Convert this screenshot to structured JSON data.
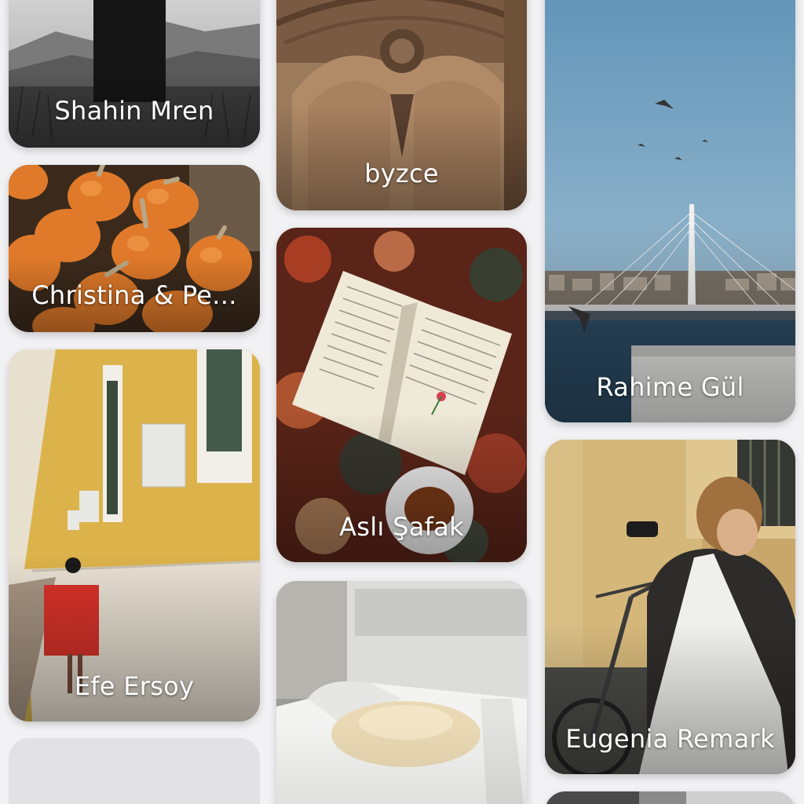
{
  "feed": {
    "cards": [
      {
        "author": "Shahin  Mren",
        "photo": "misty mountain meadow silhouette"
      },
      {
        "author": "Christina & Pe...",
        "photo": "pumpkins pile"
      },
      {
        "author": "Efe Ersoy",
        "photo": "yellow building street woman red dress"
      },
      {
        "author": "",
        "photo": "loading placeholder"
      },
      {
        "author": "byzce",
        "photo": "carved stone arch"
      },
      {
        "author": "Aslı Şafak",
        "photo": "open book on rug with tea"
      },
      {
        "author": "",
        "photo": "white tote bag on chair"
      },
      {
        "author": "Rahime Gül",
        "photo": "bridge over water with seagulls"
      },
      {
        "author": "Eugenia Remark",
        "photo": "woman with bicycle and tote"
      },
      {
        "author": "",
        "photo": "partial card"
      }
    ]
  },
  "colors": {
    "background": "#f2f2f4",
    "text": "#ffffff",
    "placeholder": "#e6e6e8"
  }
}
